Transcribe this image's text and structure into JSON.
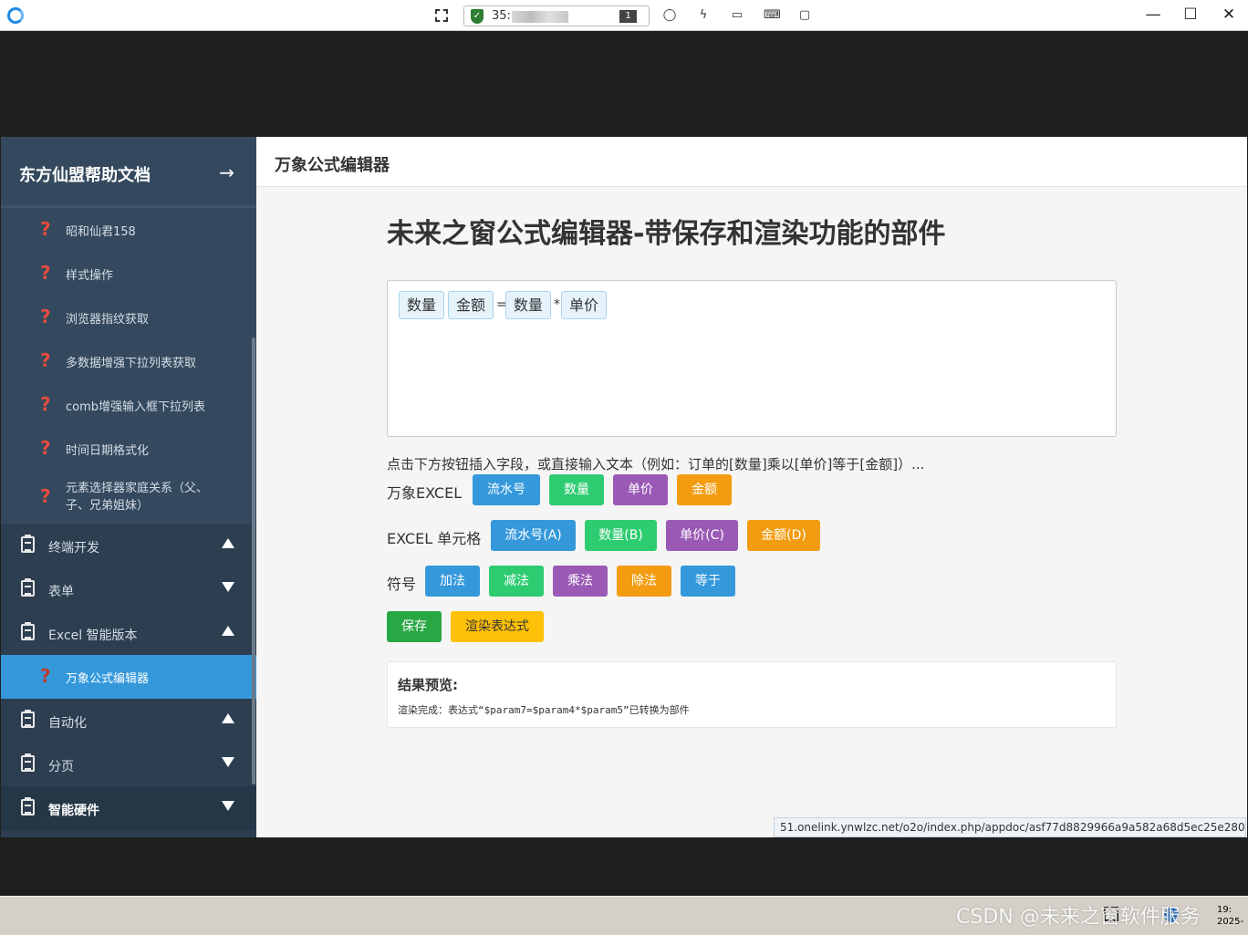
{
  "toolbar": {
    "session_prefix": "35:",
    "session_count": "1"
  },
  "sidebar": {
    "title": "东方仙盟帮助文档",
    "sub_items": [
      {
        "label": "昭和仙君158"
      },
      {
        "label": "样式操作"
      },
      {
        "label": "浏览器指纹获取"
      },
      {
        "label": "多数据增强下拉列表获取"
      },
      {
        "label": "comb增强输入框下拉列表"
      },
      {
        "label": "时间日期格式化"
      },
      {
        "label": "元素选择器家庭关系（父、子、兄弟姐妹）"
      }
    ],
    "groups": [
      {
        "label": "终端开发"
      },
      {
        "label": "表单"
      },
      {
        "label": "Excel 智能版本"
      },
      {
        "label": "自动化"
      },
      {
        "label": "分页"
      },
      {
        "label": "智能硬件"
      }
    ],
    "active_item": "万象公式编辑器"
  },
  "header": {
    "title": "万象公式编辑器"
  },
  "content": {
    "heading": "未来之窗公式编辑器-带保存和渲染功能的部件",
    "formula": {
      "chips": [
        "数量",
        "金额",
        "数量",
        "单价"
      ],
      "ops": [
        "=",
        "*"
      ]
    },
    "hint": "点击下方按钮插入字段，或直接输入文本（例如：订单的[数量]乘以[单价]等于[金额]）...",
    "rows": {
      "wanxiang_label": "万象EXCEL",
      "wanxiang_buttons": [
        "流水号",
        "数量",
        "单价",
        "金额"
      ],
      "cell_label": "EXCEL 单元格",
      "cell_buttons": [
        "流水号(A)",
        "数量(B)",
        "单价(C)",
        "金额(D)"
      ],
      "symbol_label": "符号",
      "symbol_buttons": [
        "加法",
        "减法",
        "乘法",
        "除法",
        "等于"
      ]
    },
    "save_label": "保存",
    "render_label": "渲染表达式",
    "result": {
      "title": "结果预览:",
      "text": "渲染完成：表达式“$param7=$param4*$param5”已转换为部件"
    }
  },
  "status_url": "51.onelink.ynwlzc.net/o2o/index.php/appdoc/asf77d8829966a9a582a68d5ec25e28079#",
  "taskbar": {
    "watermark": "CSDN @未来之窗软件服务",
    "clock_line1": "19:",
    "clock_line2": "2025-"
  },
  "colors": {
    "sidebar_bg": "#2c3e50",
    "active": "#3498db",
    "blue": "#3498db",
    "green": "#2ecc71",
    "purple": "#9b59b6",
    "orange": "#f39c12",
    "save": "#28a745",
    "render": "#ffc107"
  }
}
